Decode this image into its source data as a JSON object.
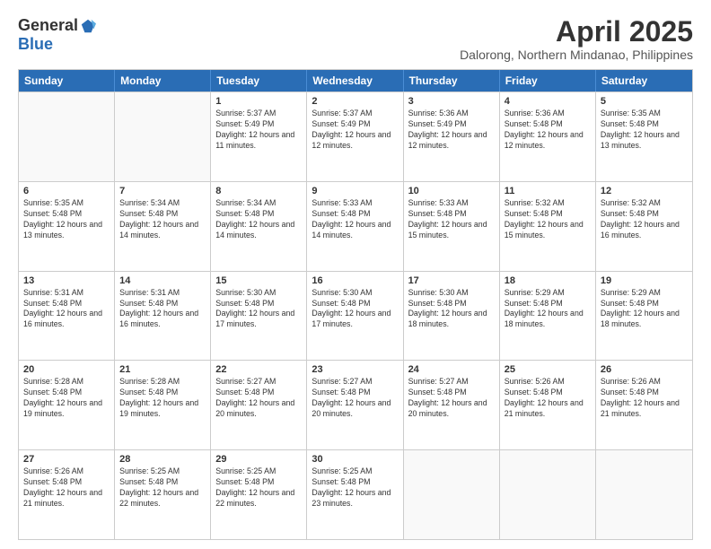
{
  "logo": {
    "general": "General",
    "blue": "Blue"
  },
  "header": {
    "month": "April 2025",
    "location": "Dalorong, Northern Mindanao, Philippines"
  },
  "weekdays": [
    "Sunday",
    "Monday",
    "Tuesday",
    "Wednesday",
    "Thursday",
    "Friday",
    "Saturday"
  ],
  "rows": [
    [
      {
        "day": "",
        "info": "",
        "empty": true
      },
      {
        "day": "",
        "info": "",
        "empty": true
      },
      {
        "day": "1",
        "info": "Sunrise: 5:37 AM\nSunset: 5:49 PM\nDaylight: 12 hours and 11 minutes."
      },
      {
        "day": "2",
        "info": "Sunrise: 5:37 AM\nSunset: 5:49 PM\nDaylight: 12 hours and 12 minutes."
      },
      {
        "day": "3",
        "info": "Sunrise: 5:36 AM\nSunset: 5:49 PM\nDaylight: 12 hours and 12 minutes."
      },
      {
        "day": "4",
        "info": "Sunrise: 5:36 AM\nSunset: 5:48 PM\nDaylight: 12 hours and 12 minutes."
      },
      {
        "day": "5",
        "info": "Sunrise: 5:35 AM\nSunset: 5:48 PM\nDaylight: 12 hours and 13 minutes."
      }
    ],
    [
      {
        "day": "6",
        "info": "Sunrise: 5:35 AM\nSunset: 5:48 PM\nDaylight: 12 hours and 13 minutes."
      },
      {
        "day": "7",
        "info": "Sunrise: 5:34 AM\nSunset: 5:48 PM\nDaylight: 12 hours and 14 minutes."
      },
      {
        "day": "8",
        "info": "Sunrise: 5:34 AM\nSunset: 5:48 PM\nDaylight: 12 hours and 14 minutes."
      },
      {
        "day": "9",
        "info": "Sunrise: 5:33 AM\nSunset: 5:48 PM\nDaylight: 12 hours and 14 minutes."
      },
      {
        "day": "10",
        "info": "Sunrise: 5:33 AM\nSunset: 5:48 PM\nDaylight: 12 hours and 15 minutes."
      },
      {
        "day": "11",
        "info": "Sunrise: 5:32 AM\nSunset: 5:48 PM\nDaylight: 12 hours and 15 minutes."
      },
      {
        "day": "12",
        "info": "Sunrise: 5:32 AM\nSunset: 5:48 PM\nDaylight: 12 hours and 16 minutes."
      }
    ],
    [
      {
        "day": "13",
        "info": "Sunrise: 5:31 AM\nSunset: 5:48 PM\nDaylight: 12 hours and 16 minutes."
      },
      {
        "day": "14",
        "info": "Sunrise: 5:31 AM\nSunset: 5:48 PM\nDaylight: 12 hours and 16 minutes."
      },
      {
        "day": "15",
        "info": "Sunrise: 5:30 AM\nSunset: 5:48 PM\nDaylight: 12 hours and 17 minutes."
      },
      {
        "day": "16",
        "info": "Sunrise: 5:30 AM\nSunset: 5:48 PM\nDaylight: 12 hours and 17 minutes."
      },
      {
        "day": "17",
        "info": "Sunrise: 5:30 AM\nSunset: 5:48 PM\nDaylight: 12 hours and 18 minutes."
      },
      {
        "day": "18",
        "info": "Sunrise: 5:29 AM\nSunset: 5:48 PM\nDaylight: 12 hours and 18 minutes."
      },
      {
        "day": "19",
        "info": "Sunrise: 5:29 AM\nSunset: 5:48 PM\nDaylight: 12 hours and 18 minutes."
      }
    ],
    [
      {
        "day": "20",
        "info": "Sunrise: 5:28 AM\nSunset: 5:48 PM\nDaylight: 12 hours and 19 minutes."
      },
      {
        "day": "21",
        "info": "Sunrise: 5:28 AM\nSunset: 5:48 PM\nDaylight: 12 hours and 19 minutes."
      },
      {
        "day": "22",
        "info": "Sunrise: 5:27 AM\nSunset: 5:48 PM\nDaylight: 12 hours and 20 minutes."
      },
      {
        "day": "23",
        "info": "Sunrise: 5:27 AM\nSunset: 5:48 PM\nDaylight: 12 hours and 20 minutes."
      },
      {
        "day": "24",
        "info": "Sunrise: 5:27 AM\nSunset: 5:48 PM\nDaylight: 12 hours and 20 minutes."
      },
      {
        "day": "25",
        "info": "Sunrise: 5:26 AM\nSunset: 5:48 PM\nDaylight: 12 hours and 21 minutes."
      },
      {
        "day": "26",
        "info": "Sunrise: 5:26 AM\nSunset: 5:48 PM\nDaylight: 12 hours and 21 minutes."
      }
    ],
    [
      {
        "day": "27",
        "info": "Sunrise: 5:26 AM\nSunset: 5:48 PM\nDaylight: 12 hours and 21 minutes."
      },
      {
        "day": "28",
        "info": "Sunrise: 5:25 AM\nSunset: 5:48 PM\nDaylight: 12 hours and 22 minutes."
      },
      {
        "day": "29",
        "info": "Sunrise: 5:25 AM\nSunset: 5:48 PM\nDaylight: 12 hours and 22 minutes."
      },
      {
        "day": "30",
        "info": "Sunrise: 5:25 AM\nSunset: 5:48 PM\nDaylight: 12 hours and 23 minutes."
      },
      {
        "day": "",
        "info": "",
        "empty": true
      },
      {
        "day": "",
        "info": "",
        "empty": true
      },
      {
        "day": "",
        "info": "",
        "empty": true
      }
    ]
  ]
}
